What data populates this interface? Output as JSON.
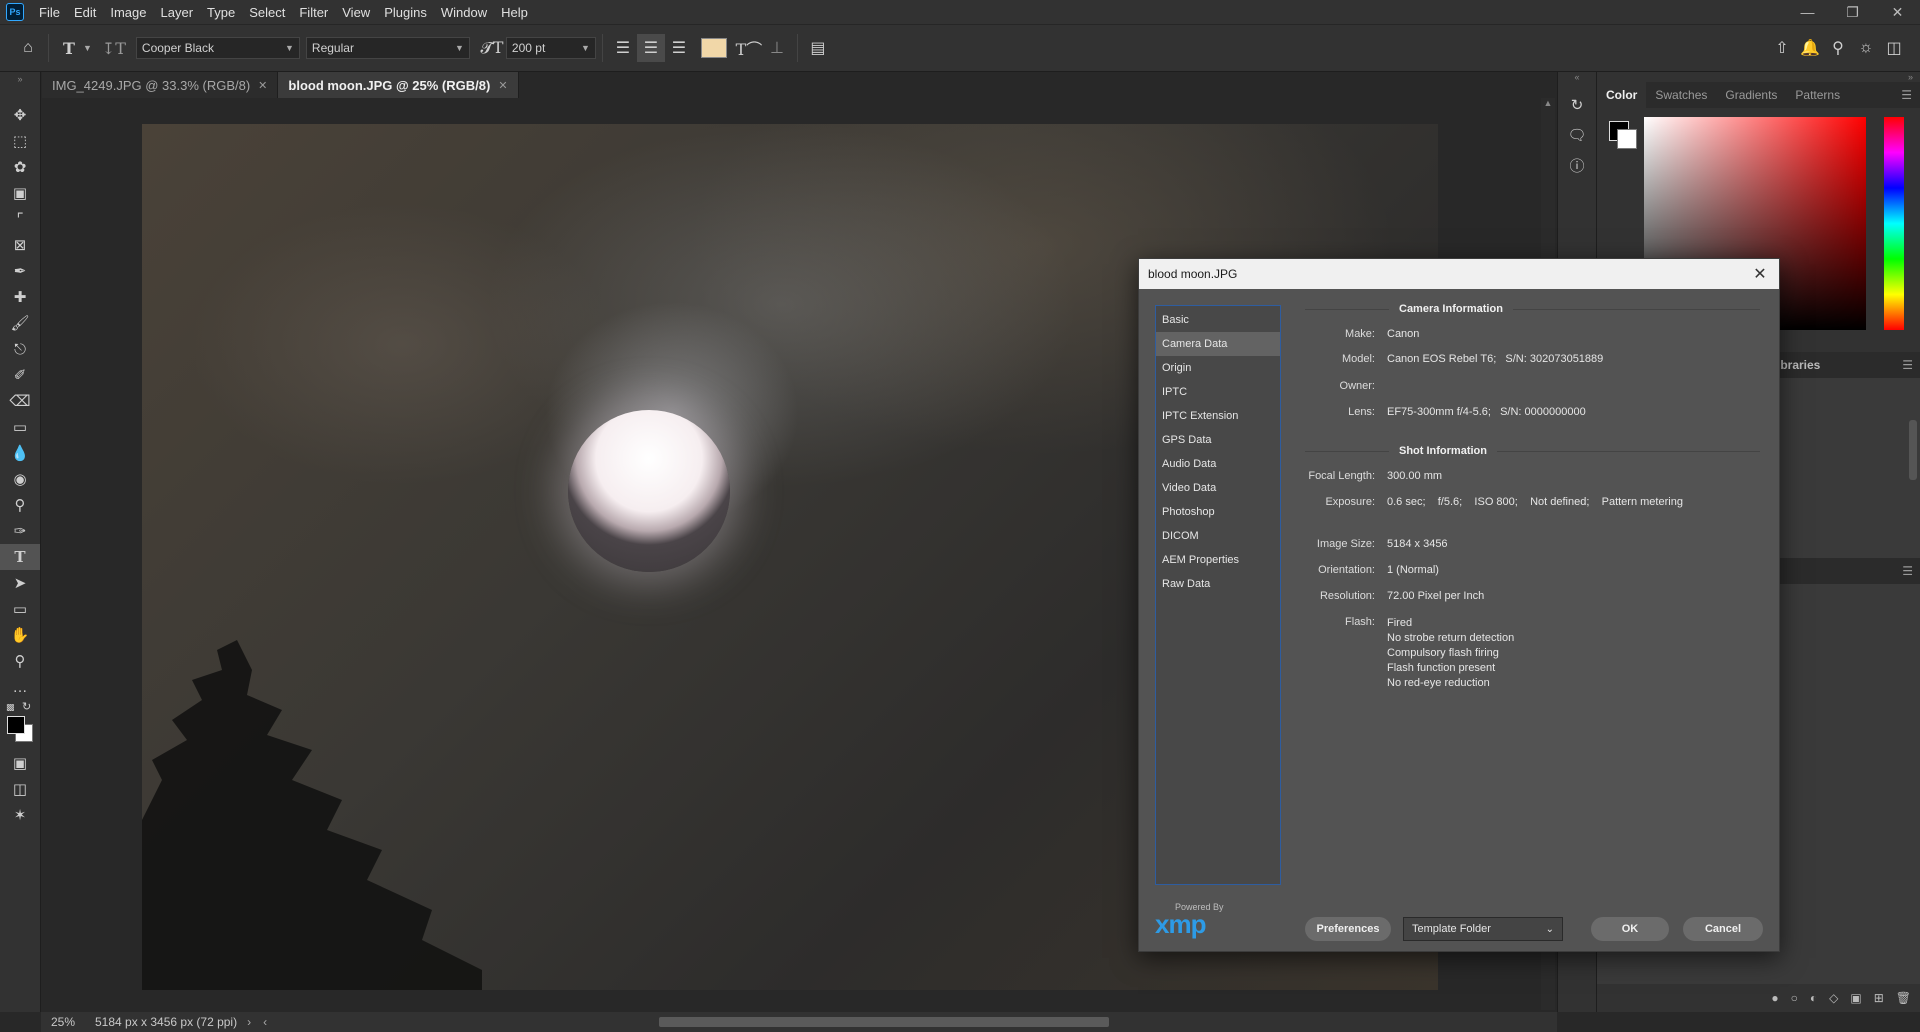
{
  "app": {
    "logo": "Ps"
  },
  "menu": [
    "File",
    "Edit",
    "Image",
    "Layer",
    "Type",
    "Select",
    "Filter",
    "View",
    "Plugins",
    "Window",
    "Help"
  ],
  "options_bar": {
    "font_family": "Cooper Black",
    "font_style": "Regular",
    "font_size": "200 pt",
    "text_color": "#f1d7a8"
  },
  "tabs": [
    {
      "label": "IMG_4249.JPG @ 33.3% (RGB/8)",
      "active": false
    },
    {
      "label": "blood moon.JPG @ 25% (RGB/8)",
      "active": true
    }
  ],
  "right_panel": {
    "tabs": [
      "Color",
      "Swatches",
      "Gradients",
      "Patterns"
    ],
    "active_tab": "Color",
    "libraries_label": "ibraries",
    "foreground_color": "#000000",
    "background_color": "#ffffff"
  },
  "status": {
    "zoom": "25%",
    "doc_info": "5184 px x 3456 px (72 ppi)"
  },
  "dialog": {
    "title": "blood moon.JPG",
    "categories": [
      "Basic",
      "Camera Data",
      "Origin",
      "IPTC",
      "IPTC Extension",
      "GPS Data",
      "Audio Data",
      "Video Data",
      "Photoshop",
      "DICOM",
      "AEM Properties",
      "Raw Data"
    ],
    "selected_category": "Camera Data",
    "camera_section": "Camera Information",
    "camera_fields": [
      {
        "label": "Make:",
        "value": "Canon"
      },
      {
        "label": "Model:",
        "value": "Canon EOS Rebel T6;   S/N: 302073051889"
      },
      {
        "label": "Owner:",
        "value": ""
      },
      {
        "label": "Lens:",
        "value": "EF75-300mm f/4-5.6;   S/N: 0000000000"
      }
    ],
    "shot_section": "Shot Information",
    "shot_fields": [
      {
        "label": "Focal Length:",
        "value": "300.00 mm"
      },
      {
        "label": "Exposure:",
        "value": "0.6 sec;    f/5.6;    ISO 800;    Not defined;    Pattern metering"
      }
    ],
    "image_fields": [
      {
        "label": "Image Size:",
        "value": "5184 x 3456"
      },
      {
        "label": "Orientation:",
        "value": "1 (Normal)"
      },
      {
        "label": "Resolution:",
        "value": "72.00 Pixel per Inch"
      }
    ],
    "flash_label": "Flash:",
    "flash_values": [
      "Fired",
      "No strobe return detection",
      "Compulsory flash firing",
      "Flash function present",
      "No red-eye reduction"
    ],
    "powered_by": "Powered By",
    "xmp_logo": "xmp",
    "preferences_label": "Preferences",
    "template_folder_label": "Template Folder",
    "ok_label": "OK",
    "cancel_label": "Cancel"
  }
}
